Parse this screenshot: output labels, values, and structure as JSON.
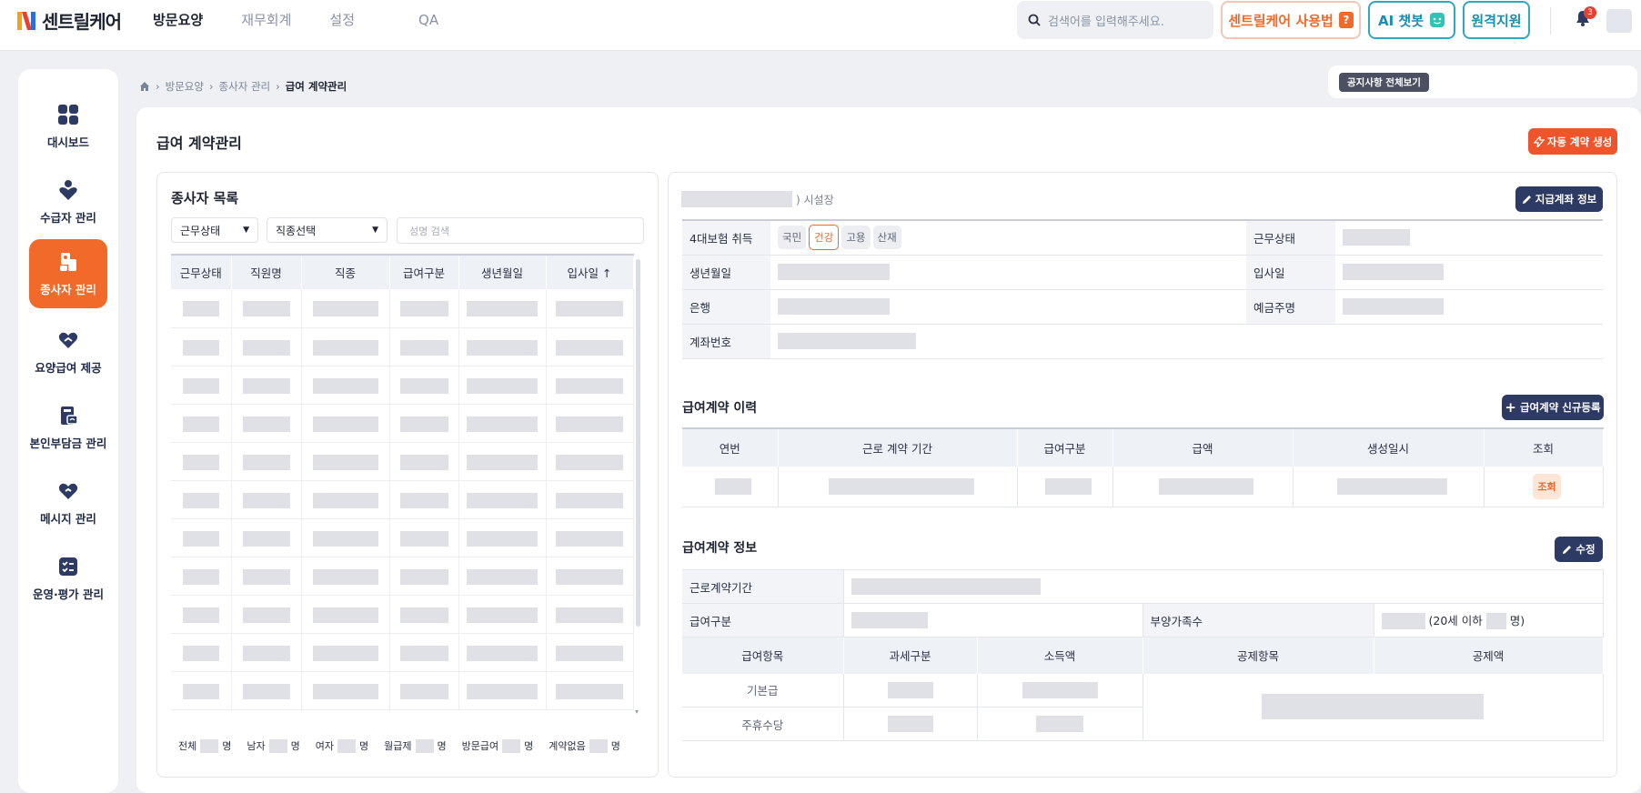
{
  "app": {
    "logo_text": "센트릴케어"
  },
  "nav": [
    "방문요양",
    "재무회계",
    "설정",
    "QA"
  ],
  "search": {
    "placeholder": "검색어를 입력해주세요."
  },
  "header_buttons": {
    "guide": "센트릴케어 사용법",
    "guide_mark": "?",
    "ai": "AI 챗봇",
    "remote": "원격지원"
  },
  "notifications": {
    "count": "3"
  },
  "sidebar": {
    "items": [
      {
        "label": "대시보드",
        "icon": "dashboard-icon"
      },
      {
        "label": "수급자 관리",
        "icon": "recipient-icon"
      },
      {
        "label": "종사자 관리",
        "icon": "staff-icon",
        "active": true
      },
      {
        "label": "요양급여 제공",
        "icon": "care-benefit-icon"
      },
      {
        "label": "본인부담금 관리",
        "icon": "copay-icon"
      },
      {
        "label": "메시지 관리",
        "icon": "message-icon"
      },
      {
        "label": "운영·평가 관리",
        "icon": "evaluation-icon"
      }
    ]
  },
  "breadcrumb": [
    "방문요양",
    "종사자 관리",
    "급여 계약관리"
  ],
  "notice": {
    "button": "공지사항 전체보기"
  },
  "page": {
    "title": "급여 계약관리",
    "auto_button": "자동 계약 생성"
  },
  "staff_list": {
    "title": "종사자 목록",
    "filter_status": "근무상태",
    "filter_job": "직종선택",
    "name_placeholder": "성명 검색",
    "columns": [
      "근무상태",
      "직원명",
      "직종",
      "급여구분",
      "생년월일",
      "입사일 ↑"
    ],
    "rows": 11,
    "stats": {
      "total": "전체",
      "male": "남자",
      "female": "여자",
      "monthly": "월급제",
      "visit_pay": "방문급여",
      "no_contract": "계약없음",
      "unit": "명"
    }
  },
  "detail": {
    "facility_suffix": ") 시설장",
    "account_button": "지급계좌 정보",
    "insurance_label": "4대보험 취득",
    "insurance": [
      {
        "label": "국민",
        "on": false
      },
      {
        "label": "건강",
        "on": true
      },
      {
        "label": "고용",
        "on": false
      },
      {
        "label": "산재",
        "on": false
      }
    ],
    "work_status_label": "근무상태",
    "birth_label": "생년월일",
    "join_label": "입사일",
    "bank_label": "은행",
    "holder_label": "예금주명",
    "account_label": "계좌번호"
  },
  "history": {
    "title": "급여계약 이력",
    "new_button": "급여계약 신규등록",
    "columns": [
      "연번",
      "근로 계약 기간",
      "급여구분",
      "급액",
      "생성일시",
      "조회"
    ],
    "view_label": "조회"
  },
  "contract": {
    "title": "급여계약 정보",
    "edit_button": "수정",
    "period_label": "근로계약기간",
    "type_label": "급여구분",
    "dependents_label": "부양가족수",
    "under20_prefix": "(20세 이하",
    "under20_suffix": "명)",
    "columns": [
      "급여항목",
      "과세구분",
      "소득액",
      "공제항목",
      "공제액"
    ],
    "items": [
      "기본급",
      "주휴수당"
    ]
  },
  "colors": {
    "accent": "#f26a2a",
    "navy": "#2d3a63",
    "teal": "#31a6c4"
  }
}
